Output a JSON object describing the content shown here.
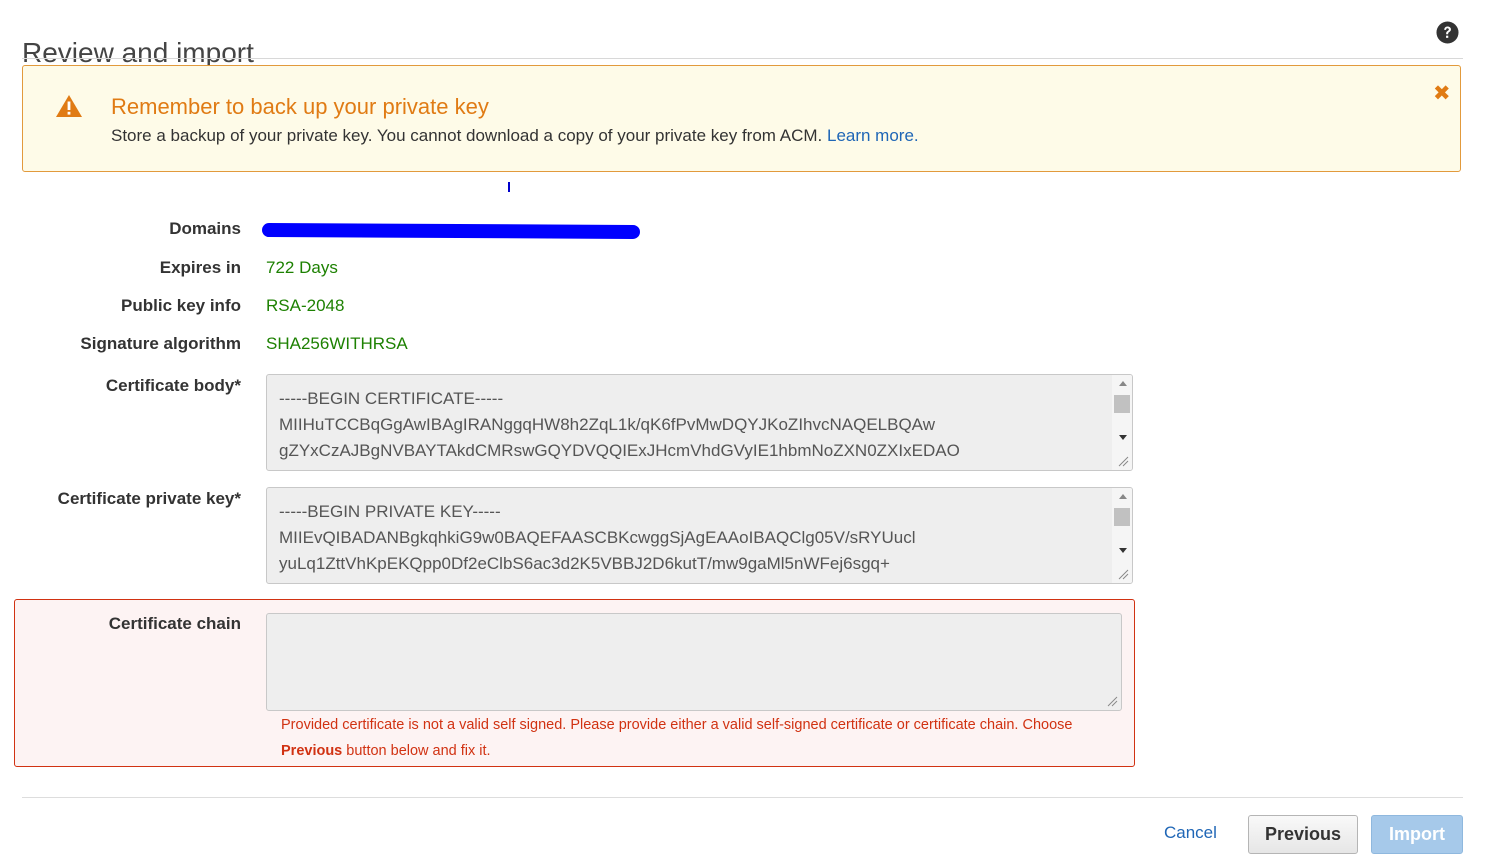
{
  "header": {
    "title": "Review and import",
    "help_icon": "question-circle-icon"
  },
  "alert": {
    "icon": "warning-triangle-icon",
    "title": "Remember to back up your private key",
    "message": "Store a backup of your private key. You cannot download a copy of your private key from ACM.",
    "link_text": "Learn more.",
    "close_icon": "close-icon",
    "colors": {
      "accent": "#e07b14",
      "background": "#fefbe8",
      "link": "#1f66b6"
    }
  },
  "details": {
    "domains_label": "Domains",
    "expires_label": "Expires in",
    "expires_value": "722 Days",
    "public_key_label": "Public key info",
    "public_key_value": "RSA-2048",
    "signature_label": "Signature algorithm",
    "signature_value": "SHA256WITHRSA",
    "value_color": "#1d8102"
  },
  "certificate_body": {
    "label": "Certificate body*",
    "value": "-----BEGIN CERTIFICATE-----\nMIIHuTCCBqGgAwIBAgIRANggqHW8h2ZqL1k/qK6fPvMwDQYJKoZIhvcNAQELBQAw\ngZYxCzAJBgNVBAYTAkdCMRswGQYDVQQIExJHcmVhdGVyIE1hbmNoZXN0ZXIxEDAO"
  },
  "certificate_private_key": {
    "label": "Certificate private key*",
    "value": "-----BEGIN PRIVATE KEY-----\nMIIEvQIBADANBgkqhkiG9w0BAQEFAASCBKcwggSjAgEAAoIBAQClg05V/sRYUucl\nyuLq1ZttVhKpEKQpp0Df2eClbS6ac3d2K5VBBJ2D6kutT/mw9gaMl5nWFej6sgq+"
  },
  "certificate_chain": {
    "label": "Certificate chain",
    "value": "",
    "error_message": "Provided certificate is not a valid self signed. Please provide either a valid self-signed certificate or certificate chain. Choose",
    "error_strong": "Previous",
    "error_suffix": "button below and fix it.",
    "error_color": "#d13212"
  },
  "footer": {
    "cancel_label": "Cancel",
    "previous_label": "Previous",
    "import_label": "Import"
  }
}
